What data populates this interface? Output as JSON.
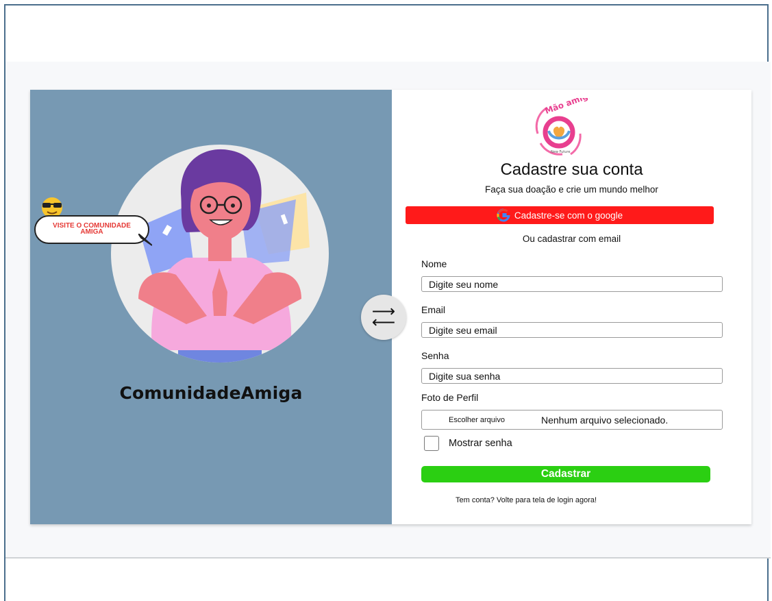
{
  "left_panel": {
    "brand_name": "ComunidadeAmiga",
    "bubble_text_line1": "VISITE O COMUNIDADE",
    "bubble_text_line2": "AMIGA"
  },
  "logo": {
    "text": "Mão amiga",
    "tagline": "New Future"
  },
  "form": {
    "title": "Cadastre sua conta",
    "subtitle": "Faça sua doação e crie um mundo melhor",
    "google_button": "Cadastre-se com o google",
    "or_text": "Ou cadastrar com email",
    "fields": {
      "name_label": "Nome",
      "name_placeholder": "Digite seu nome",
      "email_label": "Email",
      "email_placeholder": "Digite seu email",
      "password_label": "Senha",
      "password_placeholder": "Digite sua senha",
      "photo_label": "Foto de Perfil",
      "file_button": "Escolher arquivo",
      "file_status": "Nenhum arquivo selecionado."
    },
    "show_password": "Mostrar senha",
    "submit": "Cadastrar",
    "login_link": "Tem conta? Volte para tela de login agora!"
  },
  "swap_icon": "swap-arrows-icon",
  "colors": {
    "left_panel": "#7799b3",
    "google_button": "#ff1a1a",
    "submit_button": "#2bcf12",
    "bubble_text": "#e53935"
  }
}
